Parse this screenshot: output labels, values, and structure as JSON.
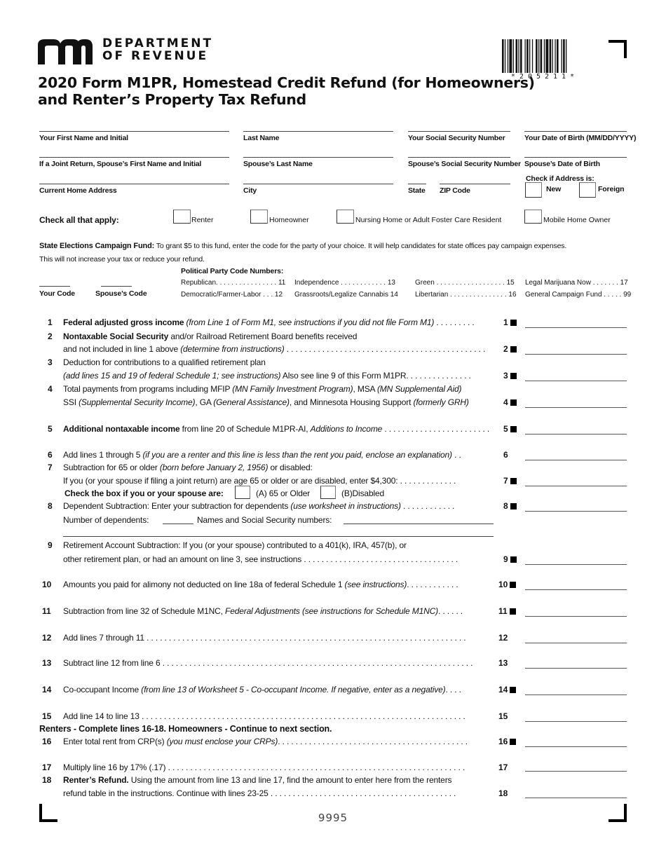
{
  "header": {
    "agency_line1": "DEPARTMENT",
    "agency_line2": "OF REVENUE",
    "title_line1": "2020 Form M1PR, Homestead Credit Refund (for Homeowners)",
    "title_line2": "and Renter’s Property Tax Refund",
    "barcode_number": "*205211*"
  },
  "identity": {
    "first_name": "Your First Name and Initial",
    "last_name": "Last Name",
    "ssn": "Your Social Security Number",
    "dob": "Your Date of Birth (MM/DD/YYYY)",
    "spouse_first": "If a Joint Return, Spouse’s First Name and Initial",
    "spouse_last": "Spouse’s Last Name",
    "spouse_ssn": "Spouse’s Social Security Number",
    "spouse_dob": "Spouse’s Date of Birth",
    "address": "Current Home Address",
    "city": "City",
    "state": "State",
    "zip": "ZIP Code",
    "address_check_label": "Check if Address is:",
    "address_new": "New",
    "address_foreign": "Foreign"
  },
  "check_all": {
    "label": "Check all that apply:",
    "options": [
      "Renter",
      "Homeowner",
      "Nursing Home or Adult Foster Care Resident",
      "Mobile Home Owner"
    ]
  },
  "campaign": {
    "heading": "State Elections Campaign Fund:",
    "text1": " To grant $5 to this fund, enter the code for the party of your choice. It will help candidates for state offices pay campaign expenses.",
    "text2": "This will not increase your tax or reduce your refund.",
    "party_heading": "Political Party Code Numbers:",
    "your_code": "Your Code",
    "spouse_code": "Spouse’s Code",
    "parties": [
      {
        "name": "Republican. . . . . . . . . . . . . . . . 11"
      },
      {
        "name": "Democratic/Farmer-Labor . . . 12"
      },
      {
        "name": "Independence . . . . . . . . . . . . 13"
      },
      {
        "name": "Grassroots/Legalize Cannabis  14"
      },
      {
        "name": "Green  . . . . . . . . . . . . . . . . . . 15"
      },
      {
        "name": "Libertarian . . . . . . . . . . . . . . . 16"
      },
      {
        "name": "Legal Marijuana Now . . . . . . . 17"
      },
      {
        "name": "General Campaign Fund . . . . . 99"
      }
    ]
  },
  "lines": {
    "l1": {
      "num": "1",
      "bold": "Federal adjusted gross income",
      "it": " (from Line 1 of Form M1, see instructions if you did not file Form M1)",
      "dots": " . . . . . . . . .",
      "ref": "1"
    },
    "l2a": {
      "num": "2",
      "bold": "Nontaxable Social Security",
      "rest": " and/or Railroad Retirement Board benefits received"
    },
    "l2b": {
      "text": "and not included in line 1 above ",
      "it": "(determine from instructions)",
      "dots": " . . . . . . . . . . . . . . . . . . . . . . . . . . . . . . . . . . . . . . . . . . . . .",
      "ref": "2"
    },
    "l3a": {
      "num": "3",
      "text": "Deduction for contributions to a qualified retirement plan"
    },
    "l3b": {
      "it": "(add lines 15 and 19 of federal Schedule 1; see instructions)",
      "text": " Also see line 9 of this Form M1PR. . . . . . . . . . . . . . .",
      "ref": "3"
    },
    "l4a": {
      "num": "4",
      "t1": "Total payments from programs including MFIP ",
      "i1": "(MN Family Investment Program)",
      "t2": ", MSA ",
      "i2": "(MN Supplemental Aid)"
    },
    "l4b": {
      "t1": "SSI ",
      "i1": "(Supplemental Security Income)",
      "t2": ", GA ",
      "i2": "(General Assistance)",
      "t3": ", and Minnesota Housing Support ",
      "i3": "(formerly GRH)",
      "ref": "4"
    },
    "l5": {
      "num": "5",
      "bold": "Additional nontaxable income",
      "text": " from line 20 of Schedule M1PR-AI, ",
      "it": "Additions to Income",
      "dots": " . . . . . . . . . . . . . . . . . . . . . . . .",
      "ref": "5"
    },
    "l6": {
      "num": "6",
      "text": "Add lines 1 through 5 ",
      "it": "(if you are a renter and this line is less than the rent you paid, enclose an explanation)",
      "dots": " . .",
      "ref": "6"
    },
    "l7a": {
      "num": "7",
      "text": "Subtraction for 65 or older ",
      "it": "(born before January 2, 1956)",
      "rest": " or disabled:"
    },
    "l7b": {
      "text": "If you (or your spouse if filing a joint return) are age 65 or older or are disabled, enter $4,300:",
      "dots": " . . . . . . . . . . . . .",
      "ref": "7"
    },
    "l7c": {
      "label": "Check the box if you or your spouse are:",
      "opt_a": "(A) 65 or Older",
      "opt_b": "(B)Disabled"
    },
    "l8a": {
      "num": "8",
      "text": "Dependent Subtraction:  Enter your subtraction for dependents ",
      "it": "(use worksheet in instructions)",
      "dots": " . . . . . . . . . . . .",
      "ref": "8"
    },
    "l8b": {
      "t1": "Number of dependents:",
      "t2": "Names and Social Security numbers:"
    },
    "l9a": {
      "num": "9",
      "text": "Retirement Account Subtraction: If you (or your spouse) contributed to a 401(k), IRA, 457(b), or"
    },
    "l9b": {
      "text": "other retirement plan, or had an amount on line 3, see instructions",
      "dots": "  . . . . . . . . . . . . . . . . . . . . . . . . . . . . . . . . . . .",
      "ref": "9"
    },
    "l10": {
      "num": "10",
      "text": "Amounts you paid for alimony not deducted on line 18a of federal Schedule 1 ",
      "it": "(see instructions)",
      "dots": ". . . . . . . . . . . .",
      "ref": "10"
    },
    "l11": {
      "num": "11",
      "text": "Subtraction from line 32 of Schedule M1NC, ",
      "it": "Federal Adjustments (see instructions for Schedule M1NC)",
      "dots": ". . . . . .",
      "ref": "11"
    },
    "l12": {
      "num": "12",
      "text": "Add lines 7 through 11",
      "dots": " . . . . . . . . . . . . . . . . . . . . . . . . . . . . . . . . . . . . . . . . . . . . . . . . . . . . . . . . . . . . . . . . . . . . . . . .",
      "ref": "12"
    },
    "l13": {
      "num": "13",
      "text": "Subtract line 12 from line 6",
      "dots": " . . . . . . . . . . . . . . . . . . . . . . . . . . . . . . . . . . . . . . . . . . . . . . . . . . . . . . . . . . . . . . . . . . . . . .",
      "ref": "13"
    },
    "l14": {
      "num": "14",
      "text": "Co-occupant Income ",
      "it": "(from line 13 of Worksheet 5 - Co-occupant Income. If negative, enter as a negative)",
      "dots": ". . . .",
      "ref": "14"
    },
    "l15": {
      "num": "15",
      "text": "Add line 14 to line 13",
      "dots": " . . . . . . . . . . . . . . . . . . . . . . . . . . . . . . . . . . . . . . . . . . . . . . . . . . . . . . . . . . . . . . . . . . . . . . . . .",
      "ref": "15"
    },
    "renters_heading": "Renters - Complete lines 16-18. Homeowners - Continue to next section.",
    "l16": {
      "num": "16",
      "text": "Enter total rent from CRP(s) ",
      "it": "(you must enclose your CRPs)",
      "dots": ". . . . . . . . . . . . . . . . . . . . . . . . . . . . . . . . . . . . . . . . . . .",
      "ref": "16"
    },
    "l17": {
      "num": "17",
      "text": "Multiply line 16 by 17% (.17)",
      "dots": " . . . . . . . . . . . . . . . . . . . . . . . . . . . . . . . . . . . . . . . . . . . . . . . . . . . . . . . . . . . . . . . . . . .",
      "ref": "17"
    },
    "l18a": {
      "num": "18",
      "bold": "Renter’s Refund.",
      "text": " Using the amount from line 13 and line 17, find the amount to enter here from the renters"
    },
    "l18b": {
      "text": "refund table in the instructions. Continue with lines 23-25",
      "dots": "  . . . . . . . . . . . . . . . . . . . . . . . . . . . . . . . . . . . . . . . . . .",
      "ref": "18"
    }
  },
  "footer": {
    "page_code": "9995"
  }
}
